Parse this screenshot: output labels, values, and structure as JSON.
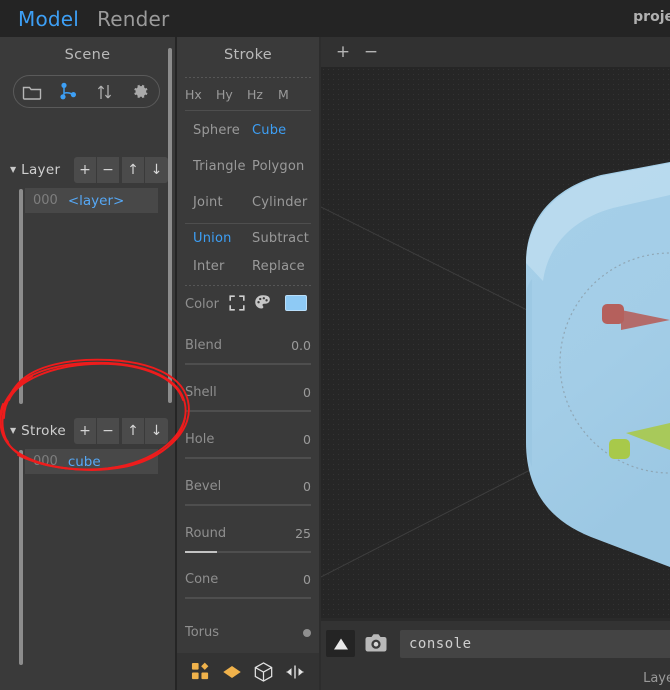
{
  "menubar": {
    "items": [
      {
        "label": "Model",
        "active": true
      },
      {
        "label": "Render",
        "active": false
      }
    ],
    "right_text": "proje"
  },
  "scene_panel": {
    "title": "Scene",
    "toolbar_icons": [
      "folder-icon",
      "node-tree-icon",
      "sort-arrows-icon",
      "gear-icon"
    ],
    "layer_group": {
      "label": "Layer",
      "buttons": [
        "+",
        "−",
        "↑",
        "↓"
      ],
      "rows": [
        {
          "index": "000",
          "name": "<layer>"
        }
      ]
    },
    "stroke_group": {
      "label": "Stroke",
      "buttons": [
        "+",
        "−",
        "↑",
        "↓"
      ],
      "rows": [
        {
          "index": "000",
          "name": "cube"
        }
      ]
    }
  },
  "stroke_panel": {
    "title": "Stroke",
    "transform_row": [
      "Hx",
      "Hy",
      "Hz",
      "M"
    ],
    "primitives": [
      {
        "left": "Sphere",
        "left_active": false,
        "right": "Cube",
        "right_active": true
      },
      {
        "left": "Triangle",
        "left_active": false,
        "right": "Polygon",
        "right_active": false
      },
      {
        "left": "Joint",
        "left_active": false,
        "right": "Cylinder",
        "right_active": false
      }
    ],
    "booleans": [
      {
        "left": "Union",
        "left_active": true,
        "right": "Subtract",
        "right_active": false
      },
      {
        "left": "Inter",
        "left_active": false,
        "right": "Replace",
        "right_active": false
      }
    ],
    "color_row": {
      "label": "Color",
      "icons": [
        "frame-brackets-icon",
        "palette-icon"
      ],
      "swatch_hex": "#8ecaf5"
    },
    "properties": [
      {
        "label": "Blend",
        "value": "0.0",
        "slider": 0,
        "control": "none"
      },
      {
        "label": "Shell",
        "value": "0",
        "slider": 0,
        "control": "none"
      },
      {
        "label": "Hole",
        "value": "0",
        "slider": 0,
        "control": "none"
      },
      {
        "label": "Bevel",
        "value": "0",
        "slider": 0,
        "control": "none"
      },
      {
        "label": "Round",
        "value": "25",
        "slider": 25,
        "control": "none"
      },
      {
        "label": "Cone",
        "value": "0",
        "slider": 0,
        "control": "none"
      },
      {
        "label": "Torus",
        "value": "",
        "slider": 0,
        "control": "dot"
      }
    ],
    "footer_icons": [
      "pieces-grid-icon",
      "diamond-icon",
      "cube-outline-icon",
      "mirror-icon"
    ]
  },
  "viewport": {
    "toolbar_buttons": [
      "+",
      "−"
    ],
    "object": {
      "name": "cube",
      "fill_hex": "#a3cfe8",
      "gizmo_axes": [
        {
          "name": "x-axis-handle",
          "color": "#b5605c"
        },
        {
          "name": "y-axis-handle",
          "color": "#a8c94a"
        }
      ]
    }
  },
  "console_bar": {
    "play_button": "▲",
    "camera_icon": "camera-icon",
    "input_value": "console",
    "status_text": "Laye"
  },
  "annotation": {
    "type": "hand-drawn-ellipse",
    "color": "#ee1c1c",
    "targets": "stroke-list-row"
  },
  "theme": {
    "bg_dark": "#242424",
    "panel_bg": "#3a3a3a",
    "accent_blue": "#3d9ff5",
    "text_muted": "#9a9a9a",
    "orange": "#f0b24b"
  }
}
